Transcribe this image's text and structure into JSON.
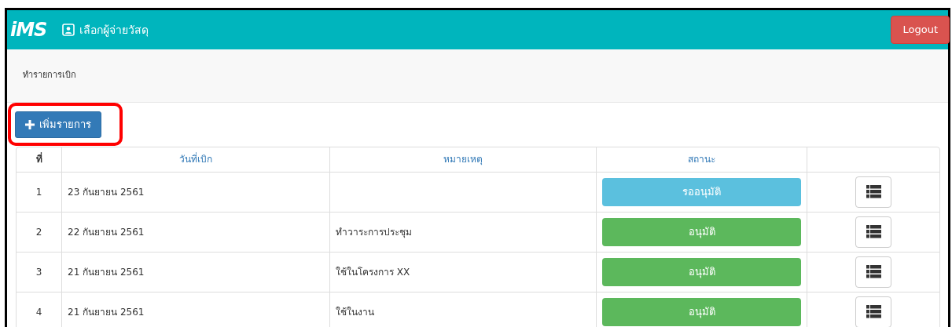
{
  "navbar": {
    "brand": "iMS",
    "menu_item": "เลือกผู้จ่ายวัสดุ",
    "logout": "Logout"
  },
  "breadcrumb": "ทำรายการเบิก",
  "add_button": {
    "label": "เพิ่มรายการ",
    "highlighted": true
  },
  "table": {
    "columns": [
      "ที่",
      "วันที่เบิก",
      "หมายเหตุ",
      "สถานะ"
    ],
    "rows": [
      {
        "no": "1",
        "date": "23 กันยายน 2561",
        "note": "",
        "status": "รออนุมัติ",
        "kind": "pending"
      },
      {
        "no": "2",
        "date": "22 กันยายน 2561",
        "note": "ทำวาระการประชุม",
        "status": "อนุมัติ",
        "kind": "approved"
      },
      {
        "no": "3",
        "date": "21 กันยายน 2561",
        "note": "ใช้ในโครงการ XX",
        "status": "อนุมัติ",
        "kind": "approved"
      },
      {
        "no": "4",
        "date": "21 กันยายน 2561",
        "note": "ใช้ในงาน",
        "status": "อนุมัติ",
        "kind": "approved"
      }
    ]
  }
}
